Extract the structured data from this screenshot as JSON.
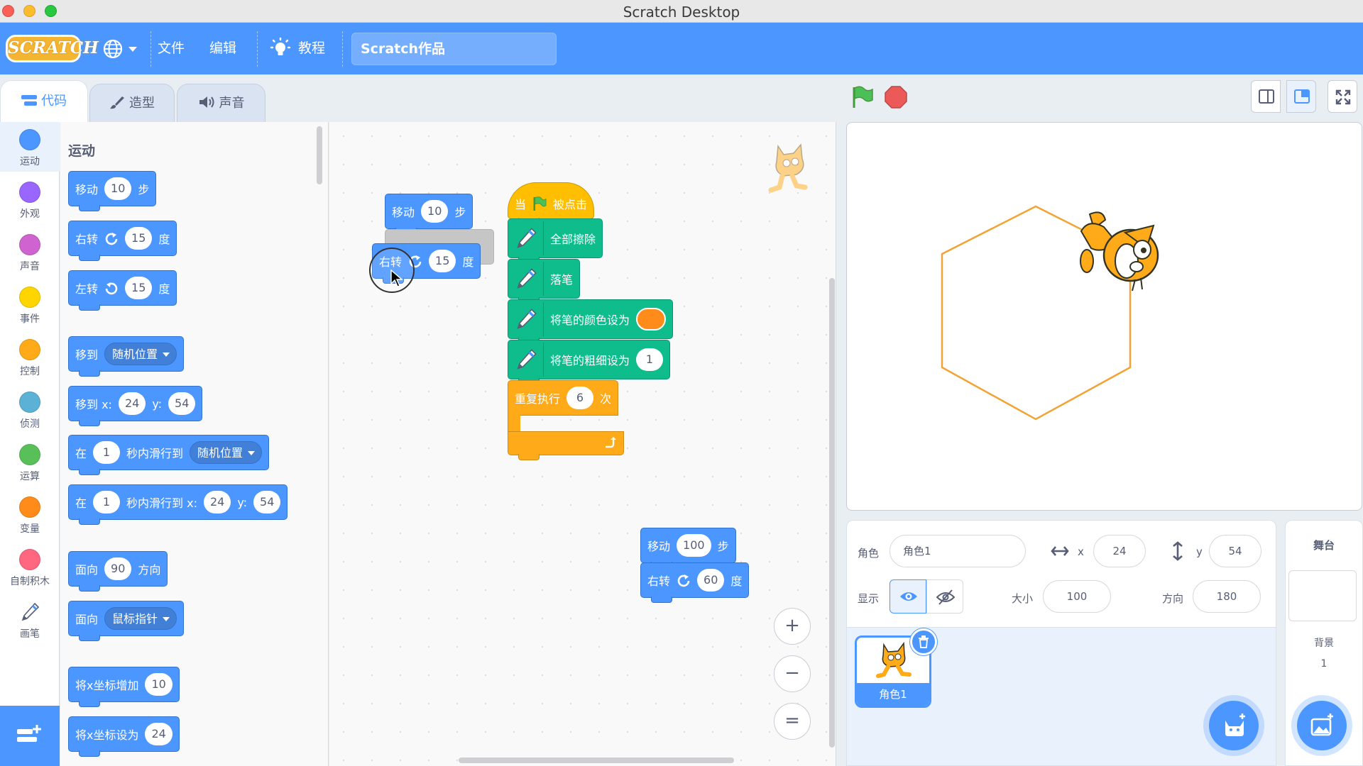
{
  "window": {
    "title": "Scratch Desktop"
  },
  "menubar": {
    "logo": "SCRATCH",
    "file": "文件",
    "edit": "编辑",
    "tutorials": "教程",
    "project_title": "Scratch作品"
  },
  "tabs": {
    "code": "代码",
    "costumes": "造型",
    "sounds": "声音"
  },
  "categories": [
    {
      "label": "运动",
      "color": "#4c97ff"
    },
    {
      "label": "外观",
      "color": "#9966ff"
    },
    {
      "label": "声音",
      "color": "#cf63cf"
    },
    {
      "label": "事件",
      "color": "#ffd500"
    },
    {
      "label": "控制",
      "color": "#ffab19"
    },
    {
      "label": "侦测",
      "color": "#5cb1d6"
    },
    {
      "label": "运算",
      "color": "#59c059"
    },
    {
      "label": "变量",
      "color": "#ff8c1a"
    },
    {
      "label": "自制积木",
      "color": "#ff6680"
    },
    {
      "label": "画笔",
      "color": "#0fbd8c"
    }
  ],
  "palette": {
    "section_title": "运动",
    "move": {
      "a": "移动",
      "n": "10",
      "b": "步"
    },
    "turn_right": {
      "a": "右转",
      "n": "15",
      "b": "度"
    },
    "turn_left": {
      "a": "左转",
      "n": "15",
      "b": "度"
    },
    "goto": {
      "a": "移到",
      "dd": "随机位置"
    },
    "goto_xy": {
      "a": "移到 x:",
      "x": "24",
      "b": "y:",
      "y": "54"
    },
    "glide": {
      "a": "在",
      "n": "1",
      "b": "秒内滑行到",
      "dd": "随机位置"
    },
    "glide_xy": {
      "a": "在",
      "n": "1",
      "b": "秒内滑行到 x:",
      "x": "24",
      "c": "y:",
      "y": "54"
    },
    "point_dir": {
      "a": "面向",
      "n": "90",
      "b": "方向"
    },
    "point_towards": {
      "a": "面向",
      "dd": "鼠标指针"
    },
    "change_x": {
      "a": "将x坐标增加",
      "n": "10"
    },
    "set_x": {
      "a": "将x坐标设为",
      "n": "24"
    }
  },
  "workspace": {
    "loose_move": {
      "a": "移动",
      "n": "10",
      "b": "步"
    },
    "drag_turn": {
      "a": "右转",
      "n": "15",
      "b": "度"
    },
    "hat": {
      "a": "当",
      "b": "被点击"
    },
    "clear": "全部擦除",
    "pen_down": "落笔",
    "set_color": "将笔的颜色设为",
    "pen_color": "#ff8c1a",
    "set_size": {
      "a": "将笔的粗细设为",
      "n": "1"
    },
    "repeat": {
      "a": "重复执行",
      "n": "6",
      "b": "次"
    },
    "move2": {
      "a": "移动",
      "n": "100",
      "b": "步"
    },
    "turn2": {
      "a": "右转",
      "n": "60",
      "b": "度"
    },
    "zoom_in": "+",
    "zoom_out": "−",
    "zoom_reset": "="
  },
  "sprite_info": {
    "sprite_label": "角色",
    "sprite_name": "角色1",
    "x_label": "x",
    "x": "24",
    "y_label": "y",
    "y": "54",
    "show_label": "显示",
    "size_label": "大小",
    "size": "100",
    "direction_label": "方向",
    "direction": "180"
  },
  "sprite_list": {
    "tile_name": "角色1"
  },
  "stage_panel": {
    "title": "舞台",
    "backdrops_label": "背景",
    "backdrops_count": "1"
  },
  "colors": {
    "accent": "#4c97ff",
    "pen_line": "#f2a333"
  }
}
